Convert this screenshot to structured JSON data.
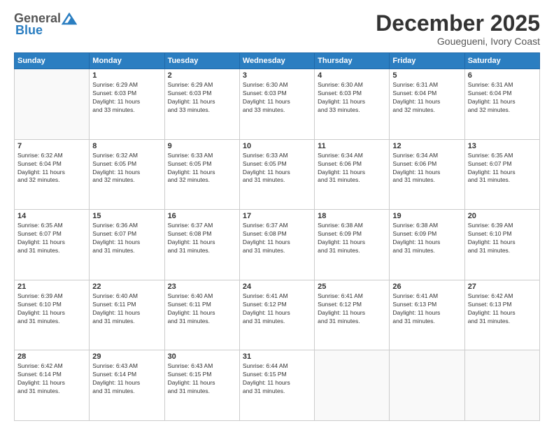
{
  "header": {
    "logo_general": "General",
    "logo_blue": "Blue",
    "month": "December 2025",
    "location": "Gouegueni, Ivory Coast"
  },
  "weekdays": [
    "Sunday",
    "Monday",
    "Tuesday",
    "Wednesday",
    "Thursday",
    "Friday",
    "Saturday"
  ],
  "weeks": [
    [
      {
        "day": "",
        "info": ""
      },
      {
        "day": "1",
        "info": "Sunrise: 6:29 AM\nSunset: 6:03 PM\nDaylight: 11 hours\nand 33 minutes."
      },
      {
        "day": "2",
        "info": "Sunrise: 6:29 AM\nSunset: 6:03 PM\nDaylight: 11 hours\nand 33 minutes."
      },
      {
        "day": "3",
        "info": "Sunrise: 6:30 AM\nSunset: 6:03 PM\nDaylight: 11 hours\nand 33 minutes."
      },
      {
        "day": "4",
        "info": "Sunrise: 6:30 AM\nSunset: 6:03 PM\nDaylight: 11 hours\nand 33 minutes."
      },
      {
        "day": "5",
        "info": "Sunrise: 6:31 AM\nSunset: 6:04 PM\nDaylight: 11 hours\nand 32 minutes."
      },
      {
        "day": "6",
        "info": "Sunrise: 6:31 AM\nSunset: 6:04 PM\nDaylight: 11 hours\nand 32 minutes."
      }
    ],
    [
      {
        "day": "7",
        "info": "Sunrise: 6:32 AM\nSunset: 6:04 PM\nDaylight: 11 hours\nand 32 minutes."
      },
      {
        "day": "8",
        "info": "Sunrise: 6:32 AM\nSunset: 6:05 PM\nDaylight: 11 hours\nand 32 minutes."
      },
      {
        "day": "9",
        "info": "Sunrise: 6:33 AM\nSunset: 6:05 PM\nDaylight: 11 hours\nand 32 minutes."
      },
      {
        "day": "10",
        "info": "Sunrise: 6:33 AM\nSunset: 6:05 PM\nDaylight: 11 hours\nand 31 minutes."
      },
      {
        "day": "11",
        "info": "Sunrise: 6:34 AM\nSunset: 6:06 PM\nDaylight: 11 hours\nand 31 minutes."
      },
      {
        "day": "12",
        "info": "Sunrise: 6:34 AM\nSunset: 6:06 PM\nDaylight: 11 hours\nand 31 minutes."
      },
      {
        "day": "13",
        "info": "Sunrise: 6:35 AM\nSunset: 6:07 PM\nDaylight: 11 hours\nand 31 minutes."
      }
    ],
    [
      {
        "day": "14",
        "info": "Sunrise: 6:35 AM\nSunset: 6:07 PM\nDaylight: 11 hours\nand 31 minutes."
      },
      {
        "day": "15",
        "info": "Sunrise: 6:36 AM\nSunset: 6:07 PM\nDaylight: 11 hours\nand 31 minutes."
      },
      {
        "day": "16",
        "info": "Sunrise: 6:37 AM\nSunset: 6:08 PM\nDaylight: 11 hours\nand 31 minutes."
      },
      {
        "day": "17",
        "info": "Sunrise: 6:37 AM\nSunset: 6:08 PM\nDaylight: 11 hours\nand 31 minutes."
      },
      {
        "day": "18",
        "info": "Sunrise: 6:38 AM\nSunset: 6:09 PM\nDaylight: 11 hours\nand 31 minutes."
      },
      {
        "day": "19",
        "info": "Sunrise: 6:38 AM\nSunset: 6:09 PM\nDaylight: 11 hours\nand 31 minutes."
      },
      {
        "day": "20",
        "info": "Sunrise: 6:39 AM\nSunset: 6:10 PM\nDaylight: 11 hours\nand 31 minutes."
      }
    ],
    [
      {
        "day": "21",
        "info": "Sunrise: 6:39 AM\nSunset: 6:10 PM\nDaylight: 11 hours\nand 31 minutes."
      },
      {
        "day": "22",
        "info": "Sunrise: 6:40 AM\nSunset: 6:11 PM\nDaylight: 11 hours\nand 31 minutes."
      },
      {
        "day": "23",
        "info": "Sunrise: 6:40 AM\nSunset: 6:11 PM\nDaylight: 11 hours\nand 31 minutes."
      },
      {
        "day": "24",
        "info": "Sunrise: 6:41 AM\nSunset: 6:12 PM\nDaylight: 11 hours\nand 31 minutes."
      },
      {
        "day": "25",
        "info": "Sunrise: 6:41 AM\nSunset: 6:12 PM\nDaylight: 11 hours\nand 31 minutes."
      },
      {
        "day": "26",
        "info": "Sunrise: 6:41 AM\nSunset: 6:13 PM\nDaylight: 11 hours\nand 31 minutes."
      },
      {
        "day": "27",
        "info": "Sunrise: 6:42 AM\nSunset: 6:13 PM\nDaylight: 11 hours\nand 31 minutes."
      }
    ],
    [
      {
        "day": "28",
        "info": "Sunrise: 6:42 AM\nSunset: 6:14 PM\nDaylight: 11 hours\nand 31 minutes."
      },
      {
        "day": "29",
        "info": "Sunrise: 6:43 AM\nSunset: 6:14 PM\nDaylight: 11 hours\nand 31 minutes."
      },
      {
        "day": "30",
        "info": "Sunrise: 6:43 AM\nSunset: 6:15 PM\nDaylight: 11 hours\nand 31 minutes."
      },
      {
        "day": "31",
        "info": "Sunrise: 6:44 AM\nSunset: 6:15 PM\nDaylight: 11 hours\nand 31 minutes."
      },
      {
        "day": "",
        "info": ""
      },
      {
        "day": "",
        "info": ""
      },
      {
        "day": "",
        "info": ""
      }
    ]
  ]
}
